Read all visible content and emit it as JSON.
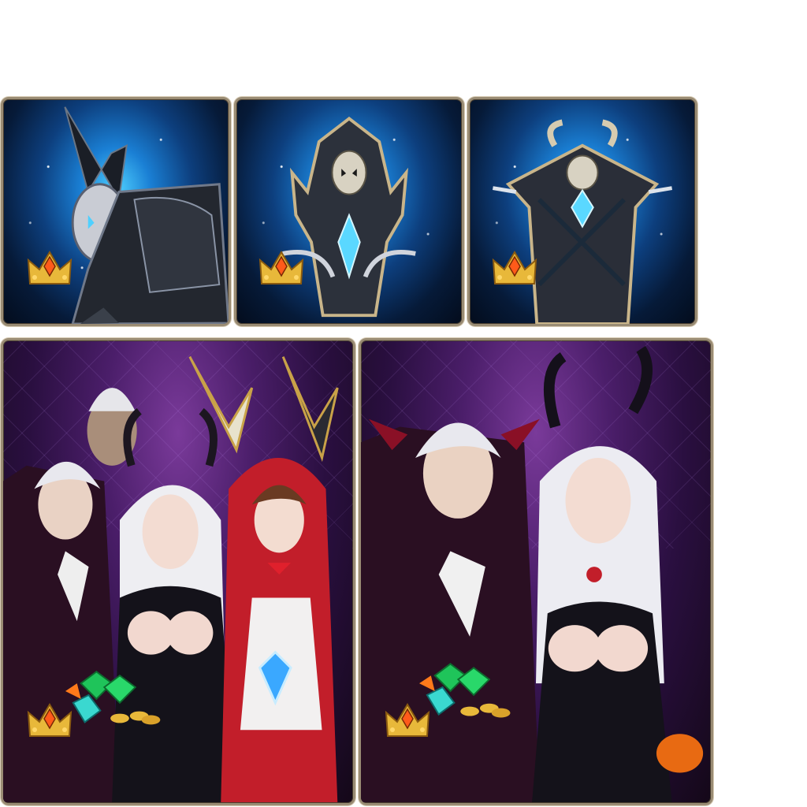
{
  "items": [
    {
      "name": "dark-knight-armor",
      "icon": "armor-crown-icon",
      "theme": "blue"
    },
    {
      "name": "skull-totem",
      "icon": "totem-crown-icon",
      "theme": "blue"
    },
    {
      "name": "horned-altar",
      "icon": "altar-crown-icon",
      "theme": "blue"
    },
    {
      "name": "halloween-party-bundle",
      "icon": "gems-crown-icon",
      "theme": "purple"
    },
    {
      "name": "vampire-duo-bundle",
      "icon": "gems-crown-icon",
      "theme": "purple"
    }
  ],
  "colors": {
    "frame": "#9a8c74",
    "blue_glow": "#4fd0ff",
    "purple_bg": "#4b1e6a",
    "crown_gold": "#e8b83a",
    "crown_gem": "#ff5a1a"
  }
}
